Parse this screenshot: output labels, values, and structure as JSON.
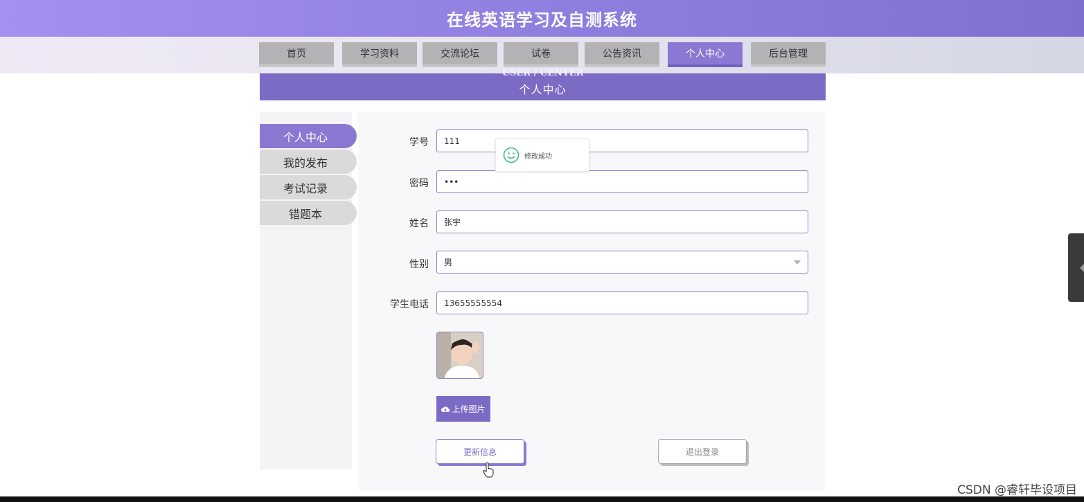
{
  "header": {
    "title": "在线英语学习及自测系统"
  },
  "nav": {
    "items": [
      {
        "label": "首页"
      },
      {
        "label": "学习资料"
      },
      {
        "label": "交流论坛"
      },
      {
        "label": "试卷"
      },
      {
        "label": "公告资讯"
      },
      {
        "label": "个人中心"
      },
      {
        "label": "后台管理"
      }
    ],
    "active": "个人中心"
  },
  "banner": {
    "en": "USER / CENTER",
    "cn": "个人中心"
  },
  "sidebar": {
    "items": [
      {
        "label": "个人中心"
      },
      {
        "label": "我的发布"
      },
      {
        "label": "考试记录"
      },
      {
        "label": "错题本"
      }
    ],
    "active": "个人中心"
  },
  "form": {
    "student_id": {
      "label": "学号",
      "value": "111"
    },
    "password": {
      "label": "密码",
      "value": "•••"
    },
    "name": {
      "label": "姓名",
      "value": "张宇"
    },
    "gender": {
      "label": "性别",
      "value": "男"
    },
    "phone": {
      "label": "学生电话",
      "value": "13655555554"
    }
  },
  "upload": {
    "label": "上传图片"
  },
  "buttons": {
    "update": "更新信息",
    "logout": "退出登录"
  },
  "toast": {
    "message": "修改成功"
  },
  "watermark": "CSDN @睿轩毕设项目",
  "colors": {
    "accent": "#7b6bc4",
    "nav_inactive": "#b5b2b5",
    "toast_icon": "#3cbf8a"
  }
}
